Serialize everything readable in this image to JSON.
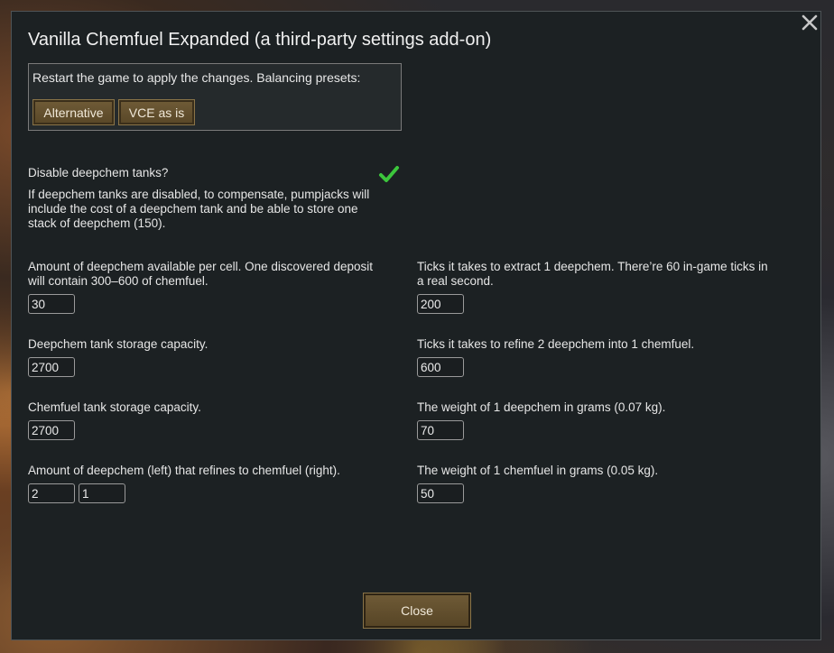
{
  "dialog": {
    "title": "Vanilla Chemfuel Expanded (a third-party settings add-on)",
    "close_icon": "close-icon",
    "close_button": "Close"
  },
  "presets": {
    "text": "Restart the game to apply the changes. Balancing presets:",
    "buttons": [
      "Alternative",
      "VCE as is"
    ]
  },
  "disable_tanks": {
    "label": "Disable deepchem tanks?",
    "checked": true,
    "check_color": "#3cc63c",
    "description_lines": [
      "If deepchem tanks are disabled, to compensate, pumpjacks will",
      "include the cost of a deepchem tank and be able to store one",
      "stack of deepchem (150)."
    ]
  },
  "settings_left": [
    {
      "label_lines": [
        "Amount of deepchem available per cell. One discovered deposit",
        "will contain 300–600 of chemfuel."
      ],
      "values": [
        "30"
      ]
    },
    {
      "label_lines": [
        "Deepchem tank storage capacity."
      ],
      "values": [
        "2700"
      ]
    },
    {
      "label_lines": [
        "Chemfuel tank storage capacity."
      ],
      "values": [
        "2700"
      ]
    },
    {
      "label_lines": [
        "Amount of deepchem (left) that refines to chemfuel (right)."
      ],
      "values": [
        "2",
        "1"
      ]
    }
  ],
  "settings_right": [
    {
      "label_lines": [
        "Ticks it takes to extract 1 deepchem. There’re 60 in-game ticks in",
        "a real second."
      ],
      "values": [
        "200"
      ]
    },
    {
      "label_lines": [
        "Ticks it takes to refine 2 deepchem into 1 chemfuel."
      ],
      "values": [
        "600"
      ]
    },
    {
      "label_lines": [
        "The weight of 1 deepchem in grams (0.07 kg)."
      ],
      "values": [
        "70"
      ]
    },
    {
      "label_lines": [
        "The weight of 1 chemfuel in grams (0.05 kg)."
      ],
      "values": [
        "50"
      ]
    }
  ]
}
